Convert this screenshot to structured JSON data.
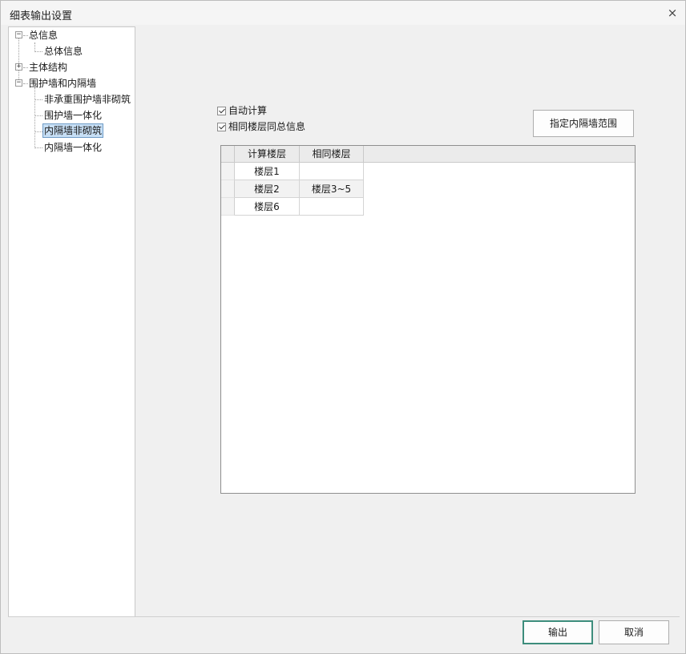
{
  "window": {
    "title": "细表输出设置",
    "close_label": "×"
  },
  "tree": {
    "root_general": "总信息",
    "general_child": "总体信息",
    "root_main": "主体结构",
    "root_walls": "围护墙和内隔墙",
    "walls_children": [
      "非承重围护墙非砌筑",
      "围护墙一体化",
      "内隔墙非砌筑",
      "内隔墙一体化"
    ],
    "collapse_glyph": "−",
    "expand_glyph": "+"
  },
  "options": {
    "auto_calc": "自动计算",
    "same_floor_summary": "相同楼层同总信息",
    "auto_calc_checked": true,
    "same_floor_checked": true
  },
  "range_button": "指定内隔墙范围",
  "grid": {
    "columns": [
      "计算楼层",
      "相同楼层"
    ],
    "rows": [
      {
        "calc_floor": "楼层1",
        "same_floor": ""
      },
      {
        "calc_floor": "楼层2",
        "same_floor": "楼层3~5"
      },
      {
        "calc_floor": "楼层6",
        "same_floor": ""
      }
    ]
  },
  "footer": {
    "ok_label": "输出",
    "cancel_label": "取消"
  }
}
